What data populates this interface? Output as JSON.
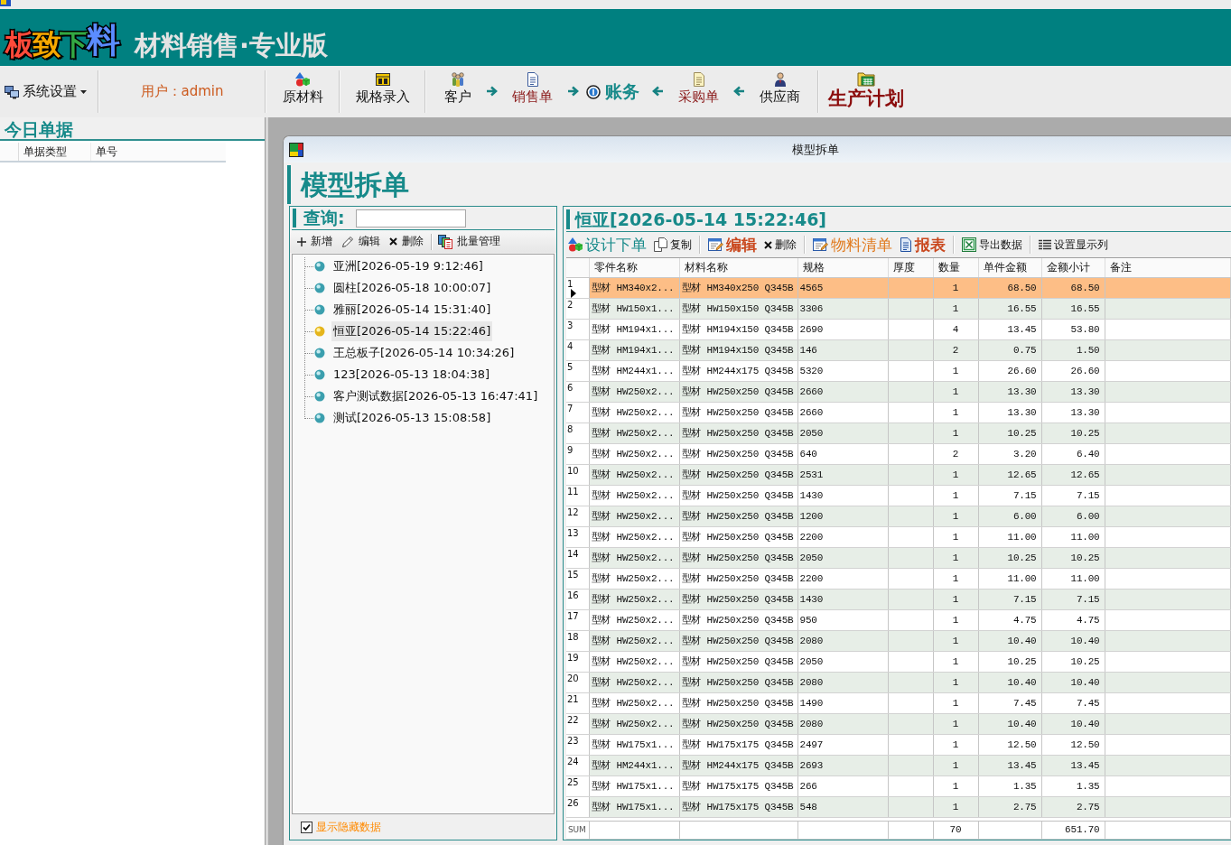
{
  "app": {
    "logo": "板致下料",
    "title": "材料销售·专业版"
  },
  "toolbar": {
    "groups": [
      [
        {
          "kind": "menu",
          "label": "系统设置"
        }
      ],
      [
        {
          "kind": "user",
          "label": "用户：admin"
        }
      ],
      [
        {
          "kind": "plain",
          "label": "原材料"
        }
      ],
      [
        {
          "kind": "plain",
          "label": "规格录入"
        }
      ],
      [
        {
          "kind": "plain",
          "label": "客户"
        },
        {
          "kind": "forward"
        },
        {
          "kind": "order",
          "label": "销售单"
        },
        {
          "kind": "forward"
        },
        {
          "kind": "ledger",
          "label": "账务"
        },
        {
          "kind": "back"
        },
        {
          "kind": "order",
          "label": "采购单"
        },
        {
          "kind": "back"
        },
        {
          "kind": "plain",
          "label": "供应商"
        }
      ],
      [
        {
          "kind": "plan",
          "label": "生产计划"
        }
      ]
    ]
  },
  "today_docs": {
    "title": "今日单据",
    "columns": [
      "单据类型",
      "单号"
    ]
  },
  "window": {
    "title": "模型拆单",
    "heading": "模型拆单",
    "query": {
      "label": "查询:"
    },
    "list_toolbar": {
      "groups": [
        [
          {
            "label": "新增"
          },
          {
            "label": "编辑"
          },
          {
            "label": "删除"
          }
        ],
        [
          {
            "label": "批量管理"
          }
        ]
      ]
    },
    "orders": [
      {
        "name": "亚洲[2026-05-19 9:12:46]",
        "selected": false
      },
      {
        "name": "圆柱[2026-05-18 10:00:07]",
        "selected": false
      },
      {
        "name": "雅丽[2026-05-14 15:31:40]",
        "selected": false
      },
      {
        "name": "恒亚[2026-05-14 15:22:46]",
        "selected": true
      },
      {
        "name": "王总板子[2026-05-14 10:34:26]",
        "selected": false
      },
      {
        "name": "123[2026-05-13 18:04:38]",
        "selected": false
      },
      {
        "name": "客户测试数据[2026-05-13 16:47:41]",
        "selected": false
      },
      {
        "name": "测试[2026-05-13 15:08:58]",
        "selected": false
      }
    ],
    "show_hidden": {
      "label": "显示隐藏数据",
      "checked": true
    },
    "detail": {
      "title": "恒亚[2026-05-14 15:22:46]",
      "toolbar": {
        "groups": [
          [
            {
              "kind": "primary",
              "label": "设计下单"
            },
            {
              "kind": "plain",
              "label": "复制"
            }
          ],
          [
            {
              "kind": "emphasis",
              "label": "编辑"
            },
            {
              "kind": "plain",
              "label": "删除"
            }
          ],
          [
            {
              "kind": "accent",
              "label": "物料清单"
            },
            {
              "kind": "emphasis",
              "label": "报表"
            }
          ],
          [
            {
              "kind": "plain",
              "label": "导出数据"
            }
          ],
          [
            {
              "kind": "plain",
              "label": "设置显示列"
            }
          ]
        ]
      },
      "table": {
        "columns": [
          "零件名称",
          "材料名称",
          "规格",
          "厚度",
          "数量",
          "单件金额",
          "金额小计",
          "备注"
        ],
        "rows": [
          {
            "number": "1",
            "selected": true,
            "part": "型材 HM340x2...",
            "material": "型材 HM340x250 Q345B",
            "spec": "4565",
            "quantity": "1",
            "unit_price": "68.50",
            "subtotal": "68.50"
          },
          {
            "number": "2",
            "selected": false,
            "part": "型材 HW150x1...",
            "material": "型材 HW150x150 Q345B",
            "spec": "3306",
            "quantity": "1",
            "unit_price": "16.55",
            "subtotal": "16.55"
          },
          {
            "number": "3",
            "selected": false,
            "part": "型材 HM194x1...",
            "material": "型材 HM194x150 Q345B",
            "spec": "2690",
            "quantity": "4",
            "unit_price": "13.45",
            "subtotal": "53.80"
          },
          {
            "number": "4",
            "selected": false,
            "part": "型材 HM194x1...",
            "material": "型材 HM194x150 Q345B",
            "spec": "146",
            "quantity": "2",
            "unit_price": "0.75",
            "subtotal": "1.50"
          },
          {
            "number": "5",
            "selected": false,
            "part": "型材 HM244x1...",
            "material": "型材 HM244x175 Q345B",
            "spec": "5320",
            "quantity": "1",
            "unit_price": "26.60",
            "subtotal": "26.60"
          },
          {
            "number": "6",
            "selected": false,
            "part": "型材 HW250x2...",
            "material": "型材 HW250x250 Q345B",
            "spec": "2660",
            "quantity": "1",
            "unit_price": "13.30",
            "subtotal": "13.30"
          },
          {
            "number": "7",
            "selected": false,
            "part": "型材 HW250x2...",
            "material": "型材 HW250x250 Q345B",
            "spec": "2660",
            "quantity": "1",
            "unit_price": "13.30",
            "subtotal": "13.30"
          },
          {
            "number": "8",
            "selected": false,
            "part": "型材 HW250x2...",
            "material": "型材 HW250x250 Q345B",
            "spec": "2050",
            "quantity": "1",
            "unit_price": "10.25",
            "subtotal": "10.25"
          },
          {
            "number": "9",
            "selected": false,
            "part": "型材 HW250x2...",
            "material": "型材 HW250x250 Q345B",
            "spec": "640",
            "quantity": "2",
            "unit_price": "3.20",
            "subtotal": "6.40"
          },
          {
            "number": "10",
            "selected": false,
            "part": "型材 HW250x2...",
            "material": "型材 HW250x250 Q345B",
            "spec": "2531",
            "quantity": "1",
            "unit_price": "12.65",
            "subtotal": "12.65"
          },
          {
            "number": "11",
            "selected": false,
            "part": "型材 HW250x2...",
            "material": "型材 HW250x250 Q345B",
            "spec": "1430",
            "quantity": "1",
            "unit_price": "7.15",
            "subtotal": "7.15"
          },
          {
            "number": "12",
            "selected": false,
            "part": "型材 HW250x2...",
            "material": "型材 HW250x250 Q345B",
            "spec": "1200",
            "quantity": "1",
            "unit_price": "6.00",
            "subtotal": "6.00"
          },
          {
            "number": "13",
            "selected": false,
            "part": "型材 HW250x2...",
            "material": "型材 HW250x250 Q345B",
            "spec": "2200",
            "quantity": "1",
            "unit_price": "11.00",
            "subtotal": "11.00"
          },
          {
            "number": "14",
            "selected": false,
            "part": "型材 HW250x2...",
            "material": "型材 HW250x250 Q345B",
            "spec": "2050",
            "quantity": "1",
            "unit_price": "10.25",
            "subtotal": "10.25"
          },
          {
            "number": "15",
            "selected": false,
            "part": "型材 HW250x2...",
            "material": "型材 HW250x250 Q345B",
            "spec": "2200",
            "quantity": "1",
            "unit_price": "11.00",
            "subtotal": "11.00"
          },
          {
            "number": "16",
            "selected": false,
            "part": "型材 HW250x2...",
            "material": "型材 HW250x250 Q345B",
            "spec": "1430",
            "quantity": "1",
            "unit_price": "7.15",
            "subtotal": "7.15"
          },
          {
            "number": "17",
            "selected": false,
            "part": "型材 HW250x2...",
            "material": "型材 HW250x250 Q345B",
            "spec": "950",
            "quantity": "1",
            "unit_price": "4.75",
            "subtotal": "4.75"
          },
          {
            "number": "18",
            "selected": false,
            "part": "型材 HW250x2...",
            "material": "型材 HW250x250 Q345B",
            "spec": "2080",
            "quantity": "1",
            "unit_price": "10.40",
            "subtotal": "10.40"
          },
          {
            "number": "19",
            "selected": false,
            "part": "型材 HW250x2...",
            "material": "型材 HW250x250 Q345B",
            "spec": "2050",
            "quantity": "1",
            "unit_price": "10.25",
            "subtotal": "10.25"
          },
          {
            "number": "20",
            "selected": false,
            "part": "型材 HW250x2...",
            "material": "型材 HW250x250 Q345B",
            "spec": "2080",
            "quantity": "1",
            "unit_price": "10.40",
            "subtotal": "10.40"
          },
          {
            "number": "21",
            "selected": false,
            "part": "型材 HW250x2...",
            "material": "型材 HW250x250 Q345B",
            "spec": "1490",
            "quantity": "1",
            "unit_price": "7.45",
            "subtotal": "7.45"
          },
          {
            "number": "22",
            "selected": false,
            "part": "型材 HW250x2...",
            "material": "型材 HW250x250 Q345B",
            "spec": "2080",
            "quantity": "1",
            "unit_price": "10.40",
            "subtotal": "10.40"
          },
          {
            "number": "23",
            "selected": false,
            "part": "型材 HW175x1...",
            "material": "型材 HW175x175 Q345B",
            "spec": "2497",
            "quantity": "1",
            "unit_price": "12.50",
            "subtotal": "12.50"
          },
          {
            "number": "24",
            "selected": false,
            "part": "型材 HM244x1...",
            "material": "型材 HM244x175 Q345B",
            "spec": "2693",
            "quantity": "1",
            "unit_price": "13.45",
            "subtotal": "13.45"
          },
          {
            "number": "25",
            "selected": false,
            "part": "型材 HW175x1...",
            "material": "型材 HW175x175 Q345B",
            "spec": "266",
            "quantity": "1",
            "unit_price": "1.35",
            "subtotal": "1.35"
          },
          {
            "number": "26",
            "selected": false,
            "part": "型材 HW175x1...",
            "material": "型材 HW175x175 Q345B",
            "spec": "548",
            "quantity": "1",
            "unit_price": "2.75",
            "subtotal": "2.75"
          }
        ],
        "sum": {
          "label": "SUM",
          "quantity": "70",
          "subtotal": "651.70"
        }
      }
    }
  }
}
